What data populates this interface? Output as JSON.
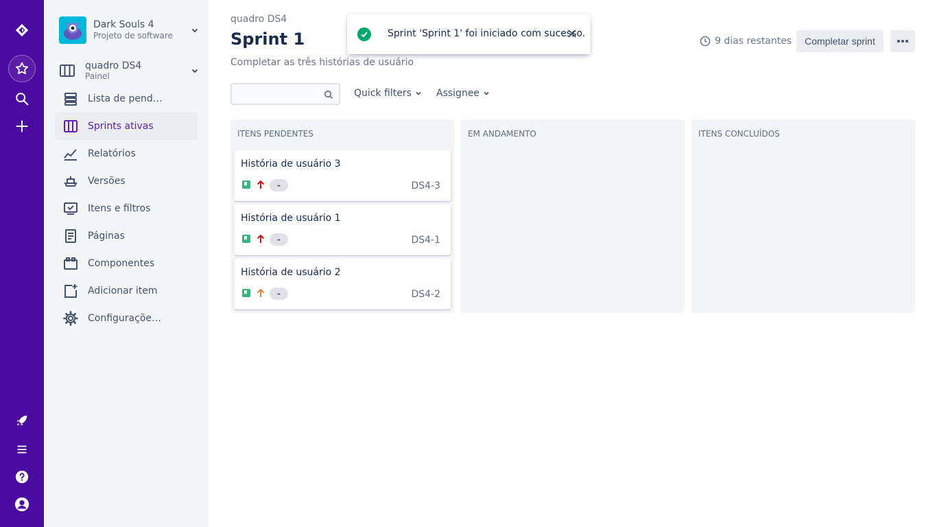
{
  "colors": {
    "rail": "#4b0aa0",
    "accent": "#5b21b6",
    "story": "#36b37e",
    "priority_high": "#cd1317",
    "priority_medium": "#e97f33",
    "success": "#00a86b"
  },
  "rail": {
    "icons": [
      "jira-logo-icon",
      "star-icon",
      "search-icon",
      "plus-icon",
      "rocket-icon",
      "menu-icon",
      "help-icon",
      "user-avatar-icon"
    ]
  },
  "project": {
    "name": "Dark Souls 4",
    "type": "Projeto de software"
  },
  "board": {
    "name": "quadro DS4",
    "type": "Painel"
  },
  "sidebar": {
    "items": [
      {
        "label": "Lista de pendê...",
        "icon": "backlog-icon"
      },
      {
        "label": "Sprints ativas",
        "icon": "board-icon",
        "active": true
      },
      {
        "label": "Relatórios",
        "icon": "reports-icon"
      },
      {
        "label": "Versões",
        "icon": "releases-icon"
      },
      {
        "label": "Itens e filtros",
        "icon": "issues-icon"
      },
      {
        "label": "Páginas",
        "icon": "pages-icon"
      },
      {
        "label": "Componentes",
        "icon": "components-icon"
      },
      {
        "label": "Adicionar item",
        "icon": "add-item-icon"
      },
      {
        "label": "Configurações ...",
        "icon": "settings-icon"
      }
    ]
  },
  "header": {
    "breadcrumb": "quadro DS4",
    "title": "Sprint 1",
    "goal": "Completar as três histórias de usuário",
    "days_remaining": "9 dias restantes",
    "complete_button": "Completar sprint"
  },
  "filters": {
    "search_placeholder": "",
    "quick_filters": "Quick filters",
    "assignee": "Assignee"
  },
  "columns": [
    {
      "title": "ITENS PENDENTES",
      "cards": [
        {
          "title": "História de usuário 3",
          "priority": "high",
          "estimate": "-",
          "key": "DS4-3"
        },
        {
          "title": "História de usuário 1",
          "priority": "high",
          "estimate": "-",
          "key": "DS4-1"
        },
        {
          "title": "História de usuário 2",
          "priority": "medium",
          "estimate": "-",
          "key": "DS4-2"
        }
      ]
    },
    {
      "title": "EM ANDAMENTO",
      "cards": []
    },
    {
      "title": "ITENS CONCLUÍDOS",
      "cards": []
    }
  ],
  "toast": {
    "message": "Sprint 'Sprint 1' foi iniciado com sucesso."
  }
}
